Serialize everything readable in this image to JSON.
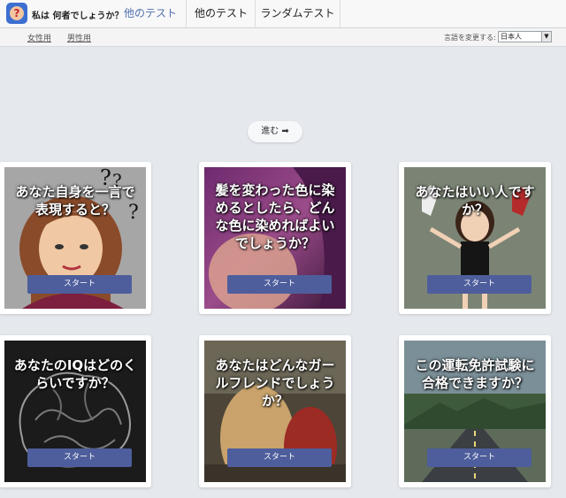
{
  "header": {
    "brand": "私は 何者でしょうか？",
    "tabs": [
      {
        "label": "他のテスト"
      },
      {
        "label": "他のテスト"
      },
      {
        "label": "ランダムテスト"
      }
    ]
  },
  "subnav": {
    "female": "女性用",
    "male": "男性用",
    "language_label": "言語を変更する:",
    "language_value": "日本人"
  },
  "next_button": "進む ➡",
  "cards": [
    {
      "title": "あなた自身を一言で表現すると？",
      "button": "スタート"
    },
    {
      "title": "髪を変わった色に染めるとしたら、どんな色に染めればよいでしょうか？",
      "button": "スタート"
    },
    {
      "title": "あなたはいい人ですか？",
      "button": "スタート"
    },
    {
      "title": "あなたのIQはどのくらいですか？",
      "button": "スタート"
    },
    {
      "title": "あなたはどんなガールフレンドでしょうか？",
      "button": "スタート"
    },
    {
      "title": "この運転免許試験に合格できますか？",
      "button": "スタート"
    }
  ],
  "colors": {
    "accent": "#4f6fb0",
    "start_button": "#4e5e9c",
    "page_bg": "#e5e8ed"
  }
}
